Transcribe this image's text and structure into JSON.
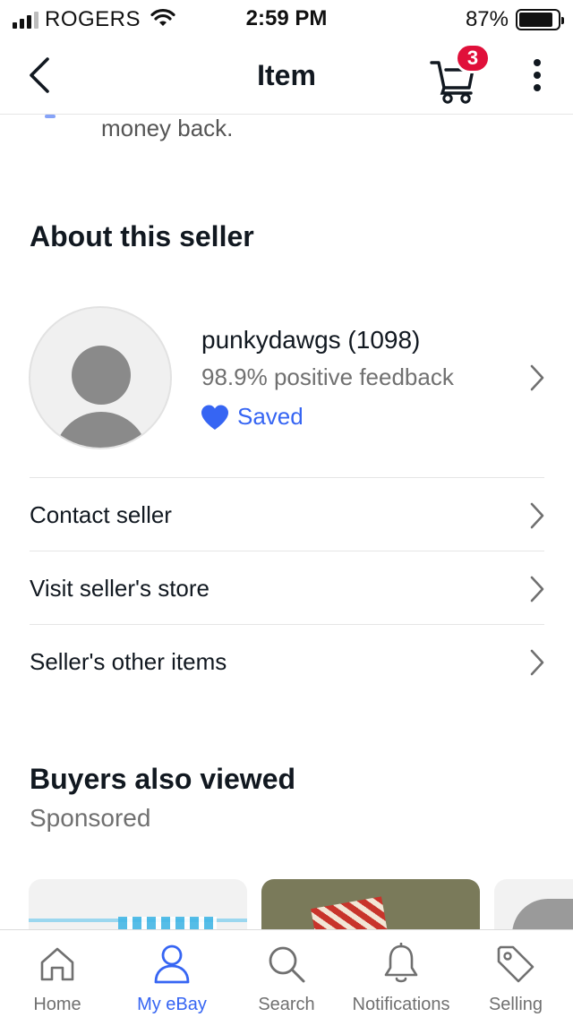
{
  "status_bar": {
    "carrier": "ROGERS",
    "time": "2:59 PM",
    "battery_percent": "87%",
    "battery_level": 0.87,
    "signal_bars": 3
  },
  "nav": {
    "title": "Item",
    "cart_count": "3",
    "back_icon": "chevron-left-icon",
    "cart_icon": "cart-icon",
    "more_icon": "more-vertical-icon"
  },
  "content": {
    "previous_text": "money back.",
    "about_title": "About this seller",
    "seller": {
      "name": "punkydawgs (1098)",
      "feedback": "98.9% positive feedback",
      "saved_label": "Saved"
    },
    "rows": [
      {
        "label": "Contact seller"
      },
      {
        "label": "Visit seller's store"
      },
      {
        "label": "Seller's other items"
      }
    ],
    "buyers_title": "Buyers also viewed",
    "sponsored_label": "Sponsored"
  },
  "tabs": [
    {
      "label": "Home",
      "icon": "home-icon",
      "active": false
    },
    {
      "label": "My eBay",
      "icon": "user-icon",
      "active": true
    },
    {
      "label": "Search",
      "icon": "search-icon",
      "active": false
    },
    {
      "label": "Notifications",
      "icon": "bell-icon",
      "active": false
    },
    {
      "label": "Selling",
      "icon": "tag-icon",
      "active": false
    }
  ],
  "colors": {
    "accent": "#3665f3",
    "badge": "#e0103a",
    "text": "#111820",
    "secondary_text": "#707070"
  }
}
